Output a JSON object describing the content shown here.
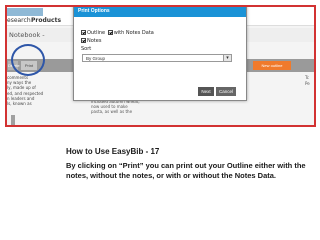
{
  "app": {
    "nav": {
      "research": "esearch",
      "products": "Products"
    },
    "notebook_title": "Notebook -",
    "toolbar": {
      "button1_label": "Delete",
      "print_label": "Print",
      "new_outline_label": "New outline"
    },
    "left_text_lines": [
      "comments",
      "ny ways the",
      "ly, made up of",
      "ed, and respected",
      "n leaders and",
      "ls, known as"
    ],
    "mid_text_lines": [
      "included autumn wheat,",
      "now used to make",
      "pasta, as well as the"
    ],
    "right_text_lines": [
      "Tc",
      "Pe"
    ]
  },
  "dialog": {
    "title": "Print Options",
    "options": {
      "outline_with_notes_data": "Outline",
      "with_notes_data": "with Notes Data",
      "notes": "Notes"
    },
    "sort_label": "Sort",
    "sort_value": "By Group",
    "next_label": "Next",
    "cancel_label": "Cancel"
  },
  "caption": {
    "title": "How to Use EasyBib - 17",
    "body": "By clicking on “Print” you can print out your Outline either with the notes, without the notes, or with or without the Notes Data."
  },
  "colors": {
    "frame": "#d23232",
    "circle": "#2e56a8",
    "dialog_header": "#1a92d6",
    "new_outline": "#f07a2c"
  }
}
